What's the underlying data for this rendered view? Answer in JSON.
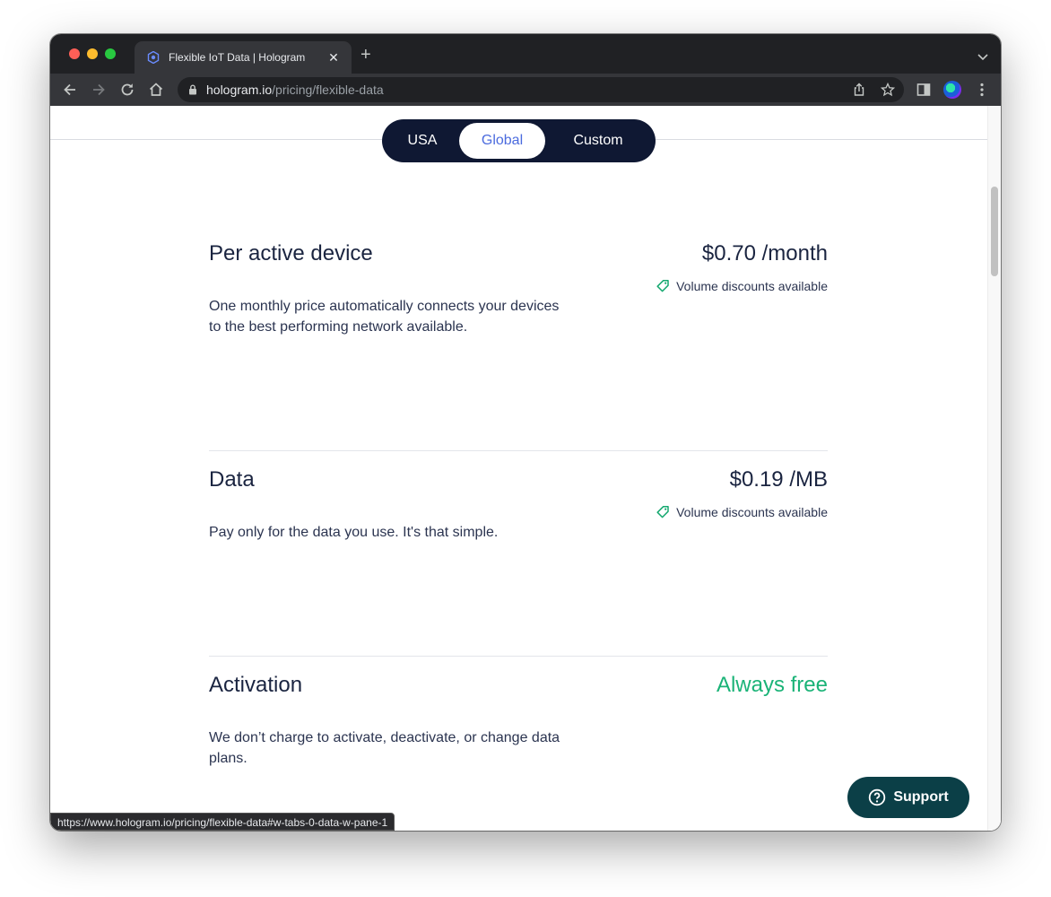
{
  "browser": {
    "tab_title": "Flexible IoT Data | Hologram",
    "tab_close": "✕",
    "new_tab": "+",
    "url_host": "hologram.io",
    "url_path": "/pricing/flexible-data",
    "status_url": "https://www.hologram.io/pricing/flexible-data#w-tabs-0-data-w-pane-1"
  },
  "region_tabs": [
    {
      "label": "USA"
    },
    {
      "label": "Global",
      "active": true
    },
    {
      "label": "Custom"
    }
  ],
  "sections": [
    {
      "title": "Per active device",
      "price": "$0.70 /month",
      "discount": "Volume discounts available",
      "description": "One monthly price automatically connects your devices to the best performing network available."
    },
    {
      "title": "Data",
      "price": "$0.19 /MB",
      "discount": "Volume discounts available",
      "description": "Pay only for the data you use. It's that simple."
    },
    {
      "title": "Activation",
      "price": "Always free",
      "description": "We don’t charge to activate, deactivate, or change data plans."
    }
  ],
  "support": {
    "label": "Support"
  },
  "colors": {
    "segment_bg": "#0f1833",
    "active_segment_text": "#4b6bde",
    "free_green": "#1ab377",
    "support_bg": "#0b3f47",
    "tag_green": "#14a86f"
  }
}
